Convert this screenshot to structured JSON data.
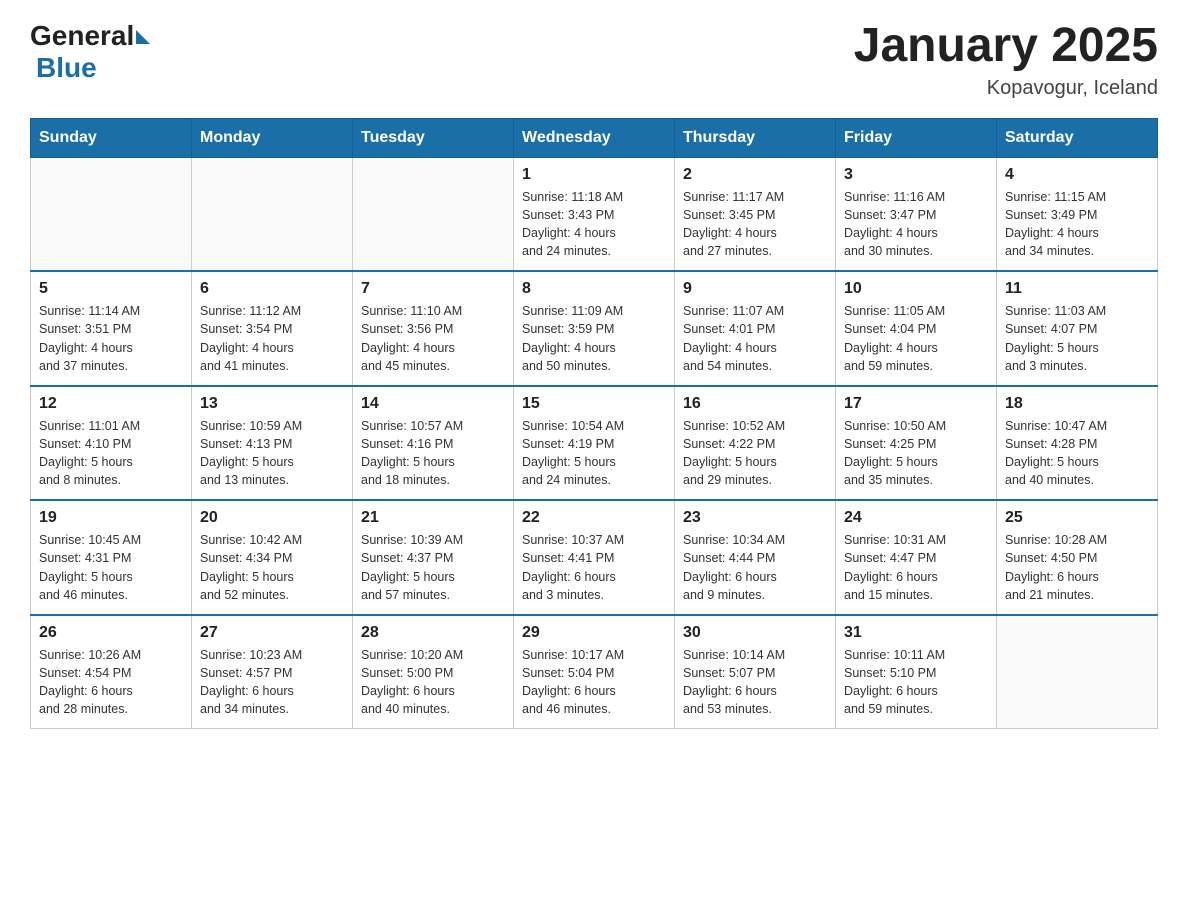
{
  "header": {
    "logo": {
      "general": "General",
      "blue": "Blue"
    },
    "title": "January 2025",
    "subtitle": "Kopavogur, Iceland"
  },
  "weekdays": [
    "Sunday",
    "Monday",
    "Tuesday",
    "Wednesday",
    "Thursday",
    "Friday",
    "Saturday"
  ],
  "weeks": [
    [
      {
        "day": "",
        "info": ""
      },
      {
        "day": "",
        "info": ""
      },
      {
        "day": "",
        "info": ""
      },
      {
        "day": "1",
        "info": "Sunrise: 11:18 AM\nSunset: 3:43 PM\nDaylight: 4 hours\nand 24 minutes."
      },
      {
        "day": "2",
        "info": "Sunrise: 11:17 AM\nSunset: 3:45 PM\nDaylight: 4 hours\nand 27 minutes."
      },
      {
        "day": "3",
        "info": "Sunrise: 11:16 AM\nSunset: 3:47 PM\nDaylight: 4 hours\nand 30 minutes."
      },
      {
        "day": "4",
        "info": "Sunrise: 11:15 AM\nSunset: 3:49 PM\nDaylight: 4 hours\nand 34 minutes."
      }
    ],
    [
      {
        "day": "5",
        "info": "Sunrise: 11:14 AM\nSunset: 3:51 PM\nDaylight: 4 hours\nand 37 minutes."
      },
      {
        "day": "6",
        "info": "Sunrise: 11:12 AM\nSunset: 3:54 PM\nDaylight: 4 hours\nand 41 minutes."
      },
      {
        "day": "7",
        "info": "Sunrise: 11:10 AM\nSunset: 3:56 PM\nDaylight: 4 hours\nand 45 minutes."
      },
      {
        "day": "8",
        "info": "Sunrise: 11:09 AM\nSunset: 3:59 PM\nDaylight: 4 hours\nand 50 minutes."
      },
      {
        "day": "9",
        "info": "Sunrise: 11:07 AM\nSunset: 4:01 PM\nDaylight: 4 hours\nand 54 minutes."
      },
      {
        "day": "10",
        "info": "Sunrise: 11:05 AM\nSunset: 4:04 PM\nDaylight: 4 hours\nand 59 minutes."
      },
      {
        "day": "11",
        "info": "Sunrise: 11:03 AM\nSunset: 4:07 PM\nDaylight: 5 hours\nand 3 minutes."
      }
    ],
    [
      {
        "day": "12",
        "info": "Sunrise: 11:01 AM\nSunset: 4:10 PM\nDaylight: 5 hours\nand 8 minutes."
      },
      {
        "day": "13",
        "info": "Sunrise: 10:59 AM\nSunset: 4:13 PM\nDaylight: 5 hours\nand 13 minutes."
      },
      {
        "day": "14",
        "info": "Sunrise: 10:57 AM\nSunset: 4:16 PM\nDaylight: 5 hours\nand 18 minutes."
      },
      {
        "day": "15",
        "info": "Sunrise: 10:54 AM\nSunset: 4:19 PM\nDaylight: 5 hours\nand 24 minutes."
      },
      {
        "day": "16",
        "info": "Sunrise: 10:52 AM\nSunset: 4:22 PM\nDaylight: 5 hours\nand 29 minutes."
      },
      {
        "day": "17",
        "info": "Sunrise: 10:50 AM\nSunset: 4:25 PM\nDaylight: 5 hours\nand 35 minutes."
      },
      {
        "day": "18",
        "info": "Sunrise: 10:47 AM\nSunset: 4:28 PM\nDaylight: 5 hours\nand 40 minutes."
      }
    ],
    [
      {
        "day": "19",
        "info": "Sunrise: 10:45 AM\nSunset: 4:31 PM\nDaylight: 5 hours\nand 46 minutes."
      },
      {
        "day": "20",
        "info": "Sunrise: 10:42 AM\nSunset: 4:34 PM\nDaylight: 5 hours\nand 52 minutes."
      },
      {
        "day": "21",
        "info": "Sunrise: 10:39 AM\nSunset: 4:37 PM\nDaylight: 5 hours\nand 57 minutes."
      },
      {
        "day": "22",
        "info": "Sunrise: 10:37 AM\nSunset: 4:41 PM\nDaylight: 6 hours\nand 3 minutes."
      },
      {
        "day": "23",
        "info": "Sunrise: 10:34 AM\nSunset: 4:44 PM\nDaylight: 6 hours\nand 9 minutes."
      },
      {
        "day": "24",
        "info": "Sunrise: 10:31 AM\nSunset: 4:47 PM\nDaylight: 6 hours\nand 15 minutes."
      },
      {
        "day": "25",
        "info": "Sunrise: 10:28 AM\nSunset: 4:50 PM\nDaylight: 6 hours\nand 21 minutes."
      }
    ],
    [
      {
        "day": "26",
        "info": "Sunrise: 10:26 AM\nSunset: 4:54 PM\nDaylight: 6 hours\nand 28 minutes."
      },
      {
        "day": "27",
        "info": "Sunrise: 10:23 AM\nSunset: 4:57 PM\nDaylight: 6 hours\nand 34 minutes."
      },
      {
        "day": "28",
        "info": "Sunrise: 10:20 AM\nSunset: 5:00 PM\nDaylight: 6 hours\nand 40 minutes."
      },
      {
        "day": "29",
        "info": "Sunrise: 10:17 AM\nSunset: 5:04 PM\nDaylight: 6 hours\nand 46 minutes."
      },
      {
        "day": "30",
        "info": "Sunrise: 10:14 AM\nSunset: 5:07 PM\nDaylight: 6 hours\nand 53 minutes."
      },
      {
        "day": "31",
        "info": "Sunrise: 10:11 AM\nSunset: 5:10 PM\nDaylight: 6 hours\nand 59 minutes."
      },
      {
        "day": "",
        "info": ""
      }
    ]
  ]
}
